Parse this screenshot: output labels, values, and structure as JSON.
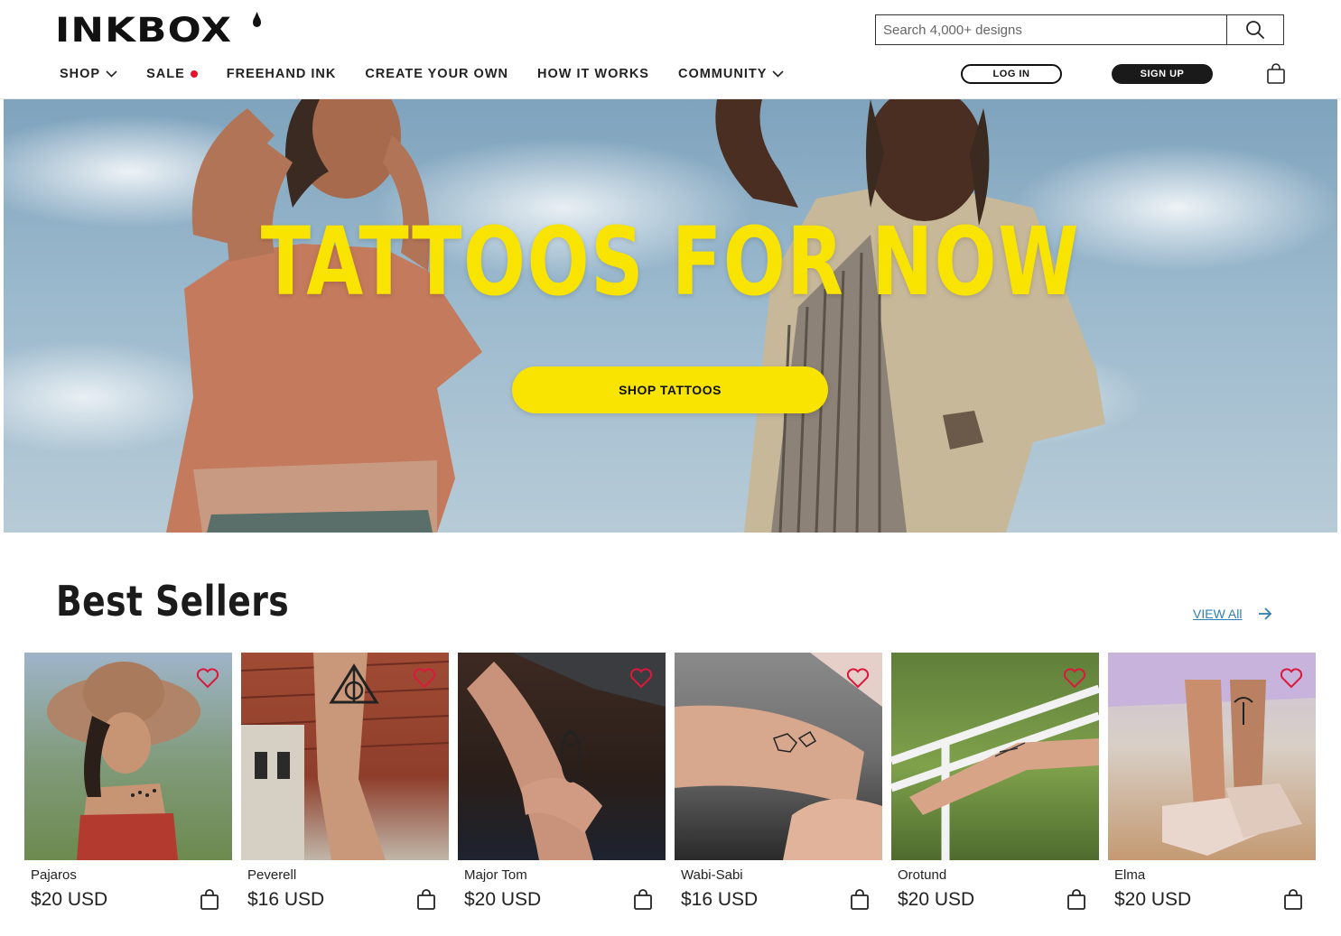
{
  "brand": {
    "logo_text": "INKBOX"
  },
  "search": {
    "placeholder": "Search 4,000+ designs",
    "icon": "search-icon"
  },
  "nav": {
    "items": [
      {
        "label": "SHOP",
        "has_dropdown": true
      },
      {
        "label": "SALE",
        "has_dot": true
      },
      {
        "label": "FREEHAND INK"
      },
      {
        "label": "CREATE YOUR OWN"
      },
      {
        "label": "HOW IT WORKS"
      },
      {
        "label": "COMMUNITY",
        "has_dropdown": true
      }
    ]
  },
  "auth": {
    "login_label": "LOG IN",
    "signup_label": "SIGN UP"
  },
  "hero": {
    "title": "TATTOOS FOR NOW",
    "cta_label": "SHOP TATTOOS"
  },
  "best_sellers": {
    "title": "Best Sellers",
    "view_all_label": "VIEW All",
    "products": [
      {
        "name": "Pajaros",
        "price": "$20 USD"
      },
      {
        "name": "Peverell",
        "price": "$16 USD"
      },
      {
        "name": "Major Tom",
        "price": "$20 USD"
      },
      {
        "name": "Wabi-Sabi",
        "price": "$16 USD"
      },
      {
        "name": "Orotund",
        "price": "$20 USD"
      },
      {
        "name": "Elma",
        "price": "$20 USD"
      }
    ]
  },
  "colors": {
    "accent_yellow": "#f8e400",
    "link_blue": "#2f7fb5",
    "sale_red": "#e8122d",
    "heart_red": "#d91a3c"
  }
}
